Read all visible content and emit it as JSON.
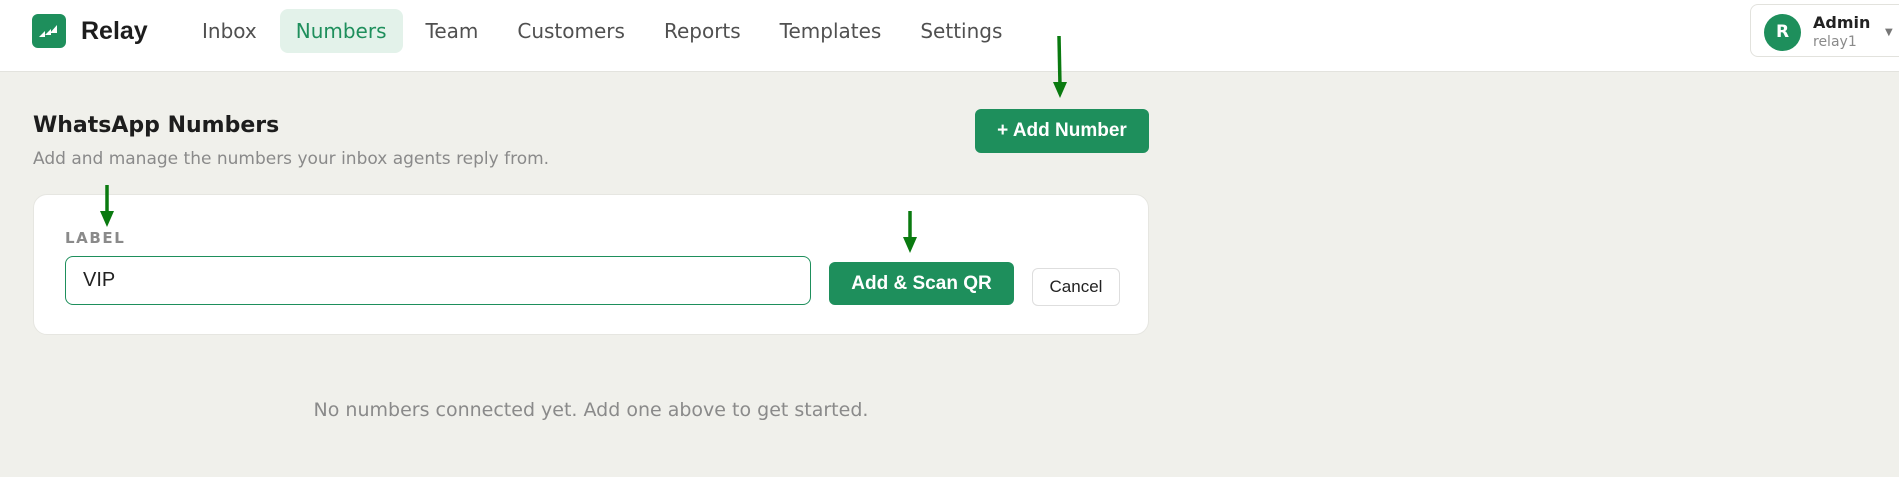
{
  "app": {
    "name": "Relay",
    "brand_color": "#1e8f5c"
  },
  "nav": {
    "items": [
      {
        "label": "Inbox"
      },
      {
        "label": "Numbers",
        "active": true
      },
      {
        "label": "Team"
      },
      {
        "label": "Customers"
      },
      {
        "label": "Reports"
      },
      {
        "label": "Templates"
      },
      {
        "label": "Settings"
      }
    ]
  },
  "user": {
    "initial": "R",
    "name": "Admin",
    "workspace": "relay1"
  },
  "page": {
    "title": "WhatsApp Numbers",
    "subtitle": "Add and manage the numbers your inbox agents reply from.",
    "add_button": "+ Add Number"
  },
  "form": {
    "label_caption": "LABEL",
    "label_value": "VIP",
    "submit_button": "Add & Scan QR",
    "cancel_button": "Cancel"
  },
  "empty_state": "No numbers connected yet. Add one above to get started.",
  "annotation": {
    "arrow_color": "#0a7a10"
  }
}
